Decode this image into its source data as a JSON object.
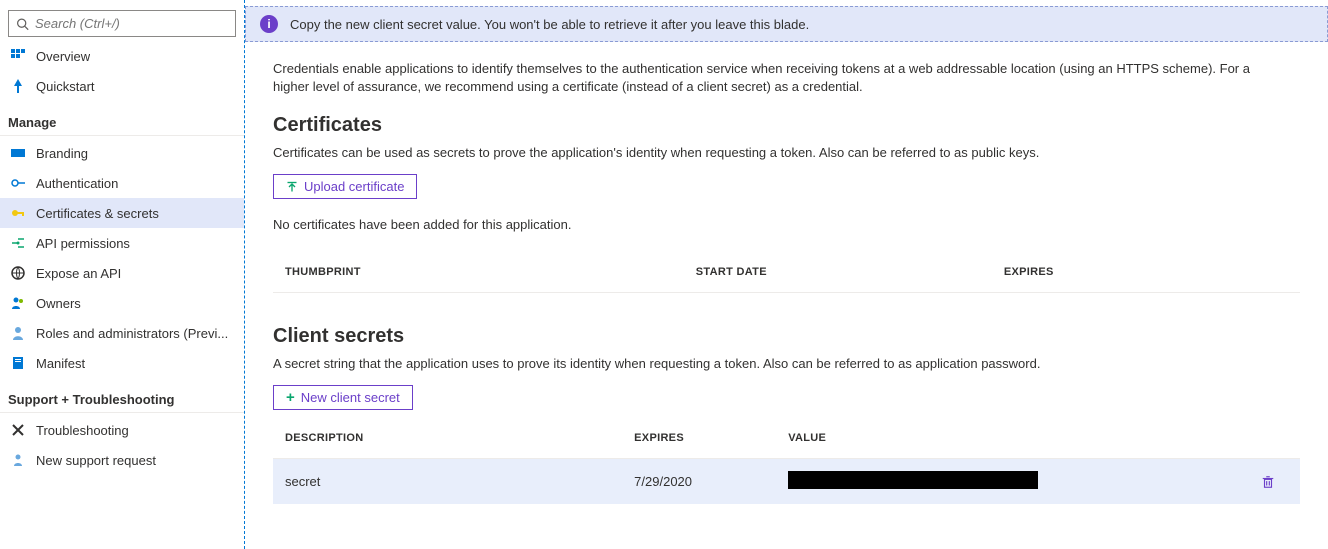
{
  "search": {
    "placeholder": "Search (Ctrl+/)"
  },
  "sidebar": {
    "top": [
      {
        "label": "Overview"
      },
      {
        "label": "Quickstart"
      }
    ],
    "sections": [
      {
        "title": "Manage",
        "items": [
          {
            "label": "Branding"
          },
          {
            "label": "Authentication"
          },
          {
            "label": "Certificates & secrets",
            "active": true
          },
          {
            "label": "API permissions"
          },
          {
            "label": "Expose an API"
          },
          {
            "label": "Owners"
          },
          {
            "label": "Roles and administrators (Previ..."
          },
          {
            "label": "Manifest"
          }
        ]
      },
      {
        "title": "Support + Troubleshooting",
        "items": [
          {
            "label": "Troubleshooting"
          },
          {
            "label": "New support request"
          }
        ]
      }
    ]
  },
  "banner": {
    "text": "Copy the new client secret value. You won't be able to retrieve it after you leave this blade."
  },
  "intro": "Credentials enable applications to identify themselves to the authentication service when receiving tokens at a web addressable location (using an HTTPS scheme). For a higher level of assurance, we recommend using a certificate (instead of a client secret) as a credential.",
  "certificates": {
    "heading": "Certificates",
    "desc": "Certificates can be used as secrets to prove the application's identity when requesting a token. Also can be referred to as public keys.",
    "upload_btn": "Upload certificate",
    "empty": "No certificates have been added for this application.",
    "cols": {
      "thumb": "THUMBPRINT",
      "start": "START DATE",
      "exp": "EXPIRES"
    }
  },
  "clientsecrets": {
    "heading": "Client secrets",
    "desc": "A secret string that the application uses to prove its identity when requesting a token. Also can be referred to as application password.",
    "new_btn": "New client secret",
    "cols": {
      "desc": "DESCRIPTION",
      "exp": "EXPIRES",
      "val": "VALUE"
    },
    "rows": [
      {
        "description": "secret",
        "expires": "7/29/2020"
      }
    ]
  }
}
